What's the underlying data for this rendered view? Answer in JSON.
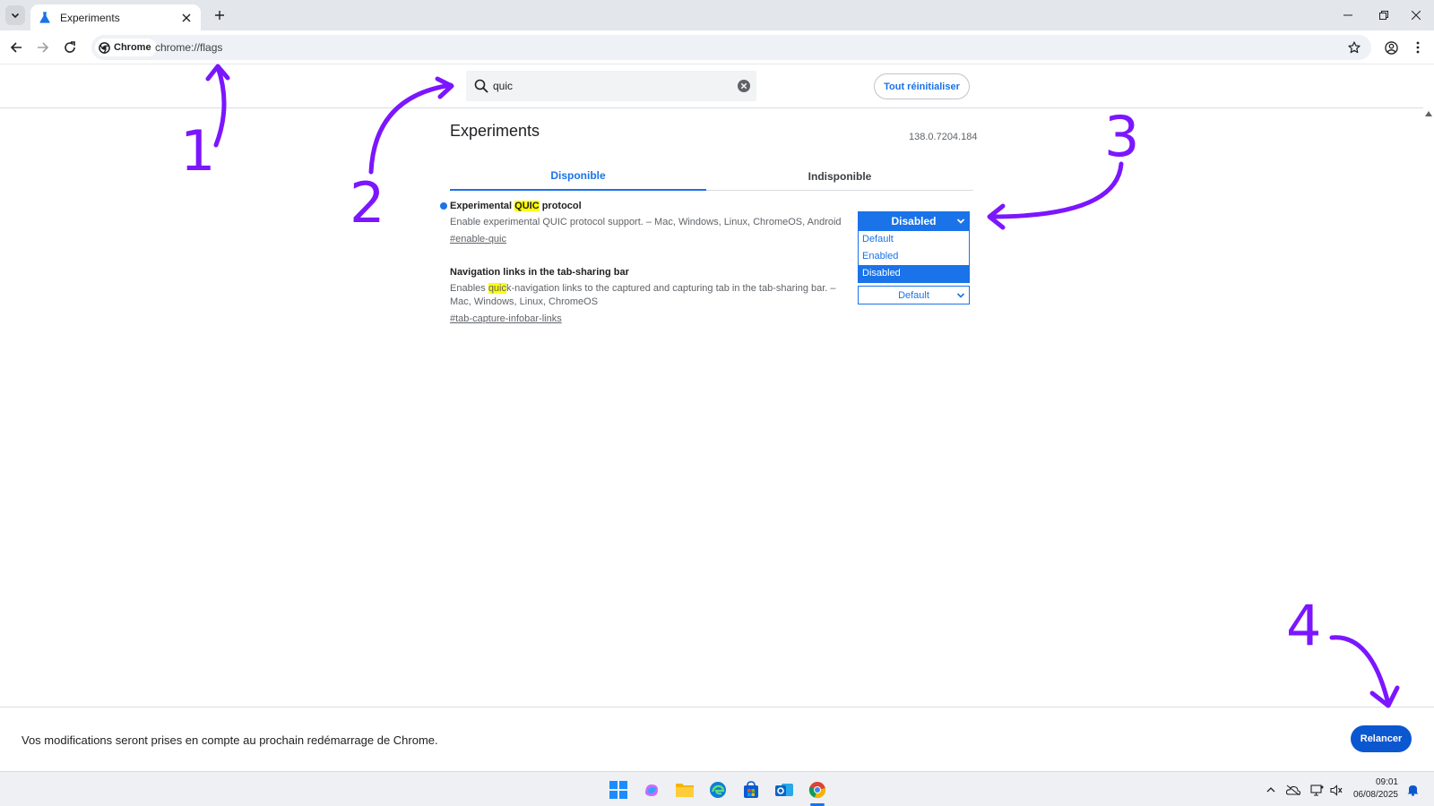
{
  "browser": {
    "tab": {
      "title": "Experiments"
    },
    "omnibox": {
      "chip_label": "Chrome",
      "url": "chrome://flags"
    }
  },
  "flags_page": {
    "search": {
      "value": "quic",
      "placeholder": ""
    },
    "reset_button_label": "Tout réinitialiser",
    "title": "Experiments",
    "version": "138.0.7204.184",
    "tabs": [
      {
        "label": "Disponible",
        "active": true
      },
      {
        "label": "Indisponible",
        "active": false
      }
    ],
    "flags": [
      {
        "title_before": "Experimental ",
        "title_match": "QUIC",
        "title_after": " protocol",
        "description": "Enable experimental QUIC protocol support. – Mac, Windows, Linux, ChromeOS, Android",
        "link": "#enable-quic",
        "select_value": "Disabled",
        "options": [
          "Default",
          "Enabled",
          "Disabled"
        ],
        "selected_option": "Disabled"
      },
      {
        "title": "Navigation links in the tab-sharing bar",
        "desc_before": "Enables ",
        "desc_match": "quic",
        "desc_after": "k-navigation links to the captured and capturing tab in the tab-sharing bar. – Mac, Windows, Linux, ChromeOS",
        "link": "#tab-capture-infobar-links",
        "select_value": "Default"
      }
    ]
  },
  "relaunch_bar": {
    "message": "Vos modifications seront prises en compte au prochain redémarrage de Chrome.",
    "button_label": "Relancer"
  },
  "taskbar": {
    "time": "09:01",
    "date": "06/08/2025"
  },
  "annotations": [
    "1",
    "2",
    "3",
    "4"
  ],
  "colors": {
    "accent": "#1a73e8",
    "annotation": "#7b16ff",
    "highlight": "#ffff00",
    "relaunch_button": "#0b57d0"
  }
}
